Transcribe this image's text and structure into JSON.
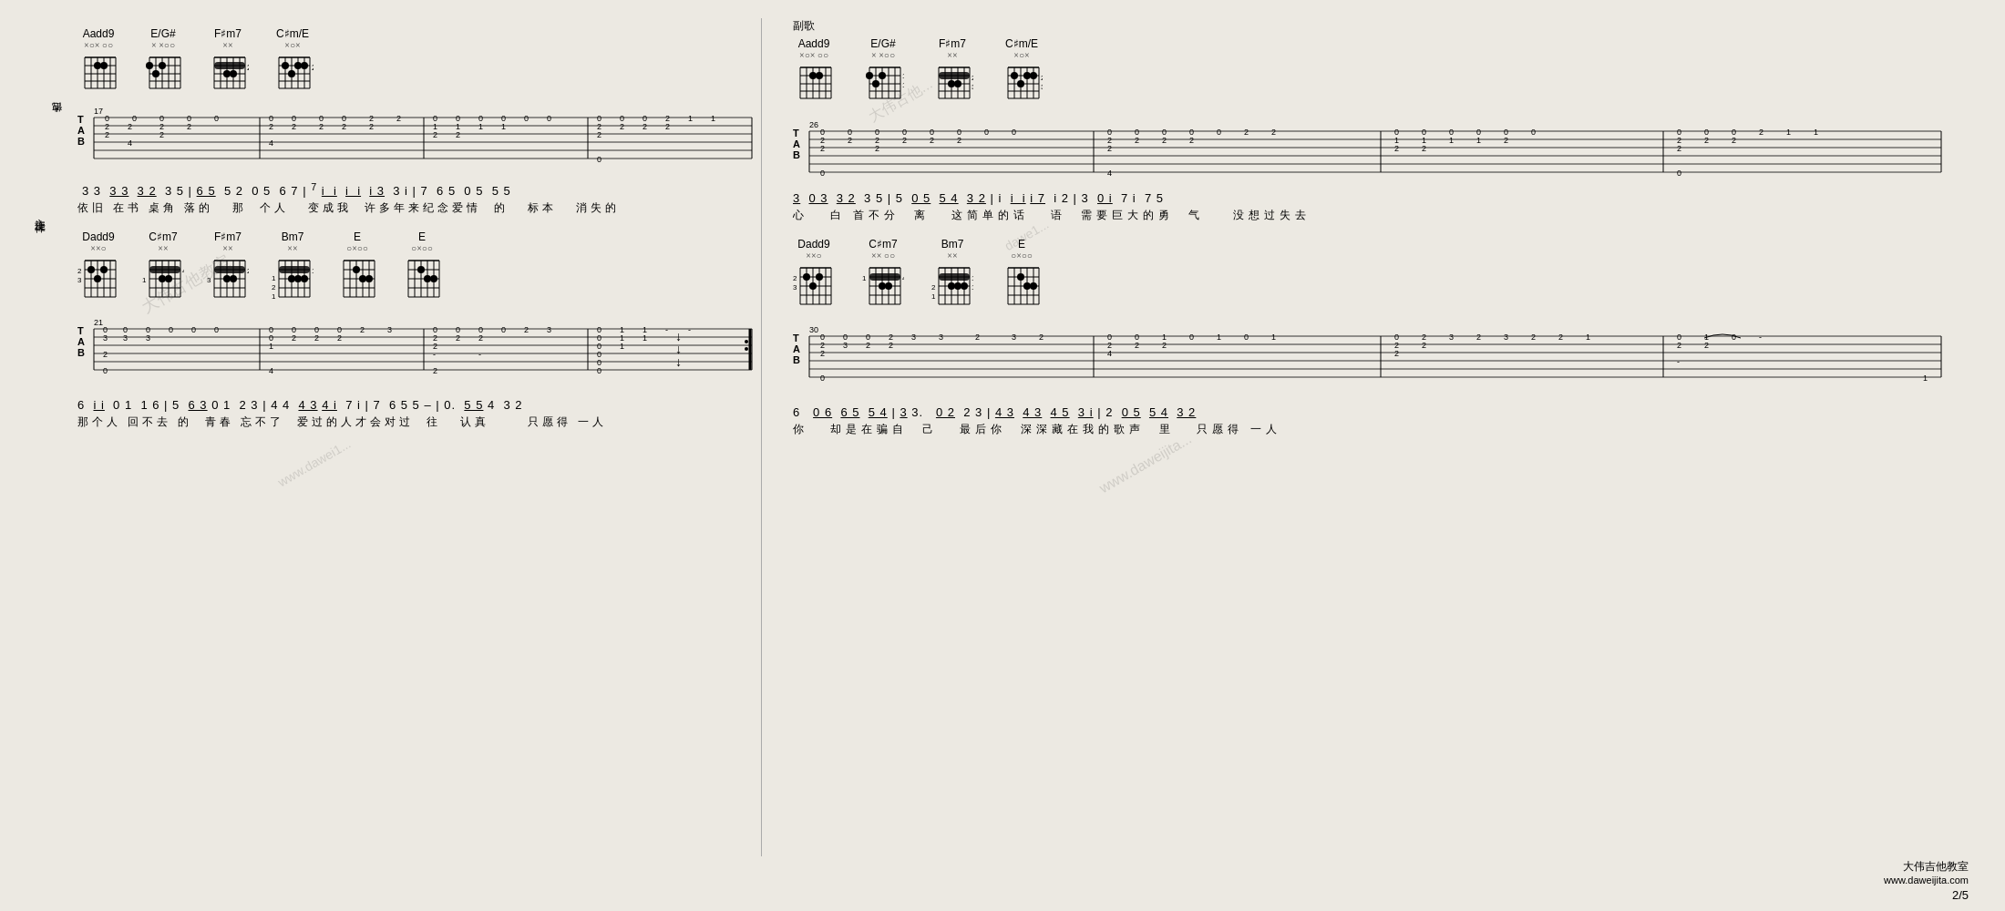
{
  "page": {
    "number": "2/5",
    "site_name": "大伟吉他教室",
    "site_url": "www.daweijita.com"
  },
  "left_section": {
    "section1": {
      "measure_start": "17",
      "chords": [
        {
          "name": "Aadd9",
          "markers": "×○× ○○"
        },
        {
          "name": "E/G#",
          "markers": "× ×○○"
        },
        {
          "name": "F#m7",
          "markers": "××"
        },
        {
          "name": "C#m/E",
          "markers": "×○×"
        }
      ],
      "notation": "3 3  3 3  3 2  3 5 | 6 5  5 2  0 5  6 7 | 7 i  i  i  i  i 3  3 i | 7  6 5  0 5  5 5",
      "lyrics": "依旧 在书 桌角 落的   那  个人   变成我  许多年来纪念爱情  的   标本   消失的"
    },
    "section2": {
      "measure_start": "21",
      "chords": [
        {
          "name": "Dadd9",
          "markers": "××○"
        },
        {
          "name": "C#m7",
          "markers": "××"
        },
        {
          "name": "F#m7",
          "markers": "××"
        },
        {
          "name": "Bm7",
          "markers": "××"
        },
        {
          "name": "E",
          "markers": "○×○○"
        },
        {
          "name": "E",
          "markers": "○×○○"
        }
      ],
      "notation": "6  i i  0 1  1 6 | 5  6 3 0 1  2 3 | 4 4  4 3 4 i  7 i | 7  6 5 5 - | 0.  5 5 4  3 2",
      "lyrics": "那个人 回不去 的  青春 忘不了  爱过的人才会对过  往   认真      只愿得 一人"
    }
  },
  "right_section": {
    "section_label": "副歌",
    "section1": {
      "measure_start": "26",
      "chords": [
        {
          "name": "Aadd9",
          "markers": "×○× ○○"
        },
        {
          "name": "E/G#",
          "markers": "× ×○○"
        },
        {
          "name": "F#m7",
          "markers": "××"
        },
        {
          "name": "C#m/E",
          "markers": "×○×"
        }
      ],
      "notation": "3  0 3  3 2  3 5 | 5  0 5  5 4  3 2 | i  i  i i 7  i 2 | 3  0 i  7 i  7 5",
      "lyrics": "心   白 首不分  离   这简单的话   语  需要巨大的勇  气    没想过失去"
    },
    "section2": {
      "measure_start": "30",
      "chords": [
        {
          "name": "Dadd9",
          "markers": "××○"
        },
        {
          "name": "C#m7",
          "markers": "×× ○○"
        },
        {
          "name": "Bm7",
          "markers": "××"
        },
        {
          "name": "E",
          "markers": "○×○○"
        }
      ],
      "notation": "6  0 6  6 5  5 4 | 3 3.  0 2  2 3 | 4 3  4 3  4 5  3 i | 2  0 5  5 4  3 2",
      "lyrics": "你   却是在骗自  己   最后你  深深藏在我的歌声  里   只愿得 一人"
    }
  }
}
